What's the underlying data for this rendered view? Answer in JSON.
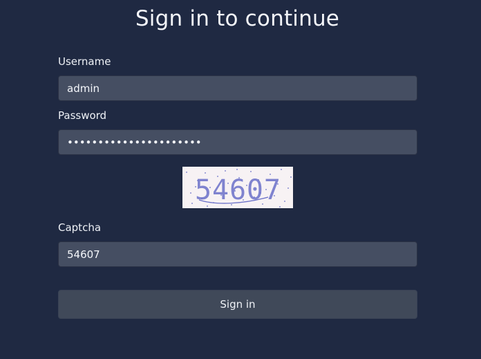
{
  "page": {
    "title": "Sign in to continue"
  },
  "form": {
    "username_label": "Username",
    "username_value": "admin",
    "password_label": "Password",
    "password_value": "1234567890123456789012",
    "captcha_image_text": "54607",
    "captcha_label": "Captcha",
    "captcha_value": "54607",
    "submit_label": "Sign in"
  },
  "colors": {
    "background": "#1f2942",
    "field_background": "#454e62",
    "button_background": "#404959",
    "captcha_background": "#f7f2f4",
    "captcha_ink": "#6a70c8"
  }
}
